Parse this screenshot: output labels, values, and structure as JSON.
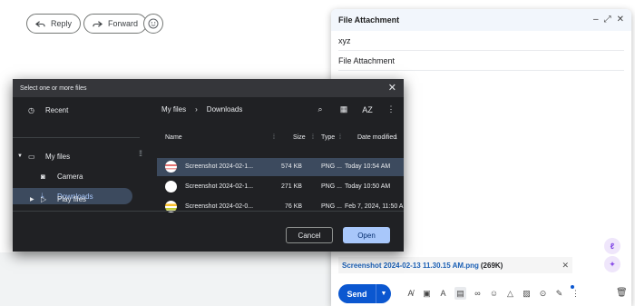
{
  "mail": {
    "reply_label": "Reply",
    "forward_label": "Forward"
  },
  "compose": {
    "title": "File Attachment",
    "to_value": "xyz",
    "subject_value": "File Attachment",
    "attachment": {
      "name": "Screenshot 2024-02-13 11.30.15 AM.png",
      "size": "(269K)"
    },
    "send_label": "Send",
    "accent_color": "#0b57d0"
  },
  "dialog": {
    "title": "Select one or more files",
    "sidebar": [
      {
        "label": "Recent",
        "icon": "clock-icon"
      },
      {
        "label": "My files",
        "icon": "laptop-icon"
      },
      {
        "label": "Camera",
        "icon": "camera-icon"
      },
      {
        "label": "Downloads",
        "icon": "download-icon"
      },
      {
        "label": "Play files",
        "icon": "play-icon"
      }
    ],
    "breadcrumb": [
      "My files",
      "Downloads"
    ],
    "sort_label": "AZ",
    "columns": {
      "name": "Name",
      "size": "Size",
      "type": "Type",
      "date": "Date modified"
    },
    "files": [
      {
        "name": "Screenshot 2024-02-1...",
        "size": "574 KB",
        "type": "PNG ...",
        "date": "Today 10:54 AM"
      },
      {
        "name": "Screenshot 2024-02-1...",
        "size": "271 KB",
        "type": "PNG ...",
        "date": "Today 10:50 AM"
      },
      {
        "name": "Screenshot 2024-02-0...",
        "size": "76 KB",
        "type": "PNG ...",
        "date": "Feb 7, 2024, 11:50 A"
      }
    ],
    "cancel_label": "Cancel",
    "open_label": "Open"
  }
}
